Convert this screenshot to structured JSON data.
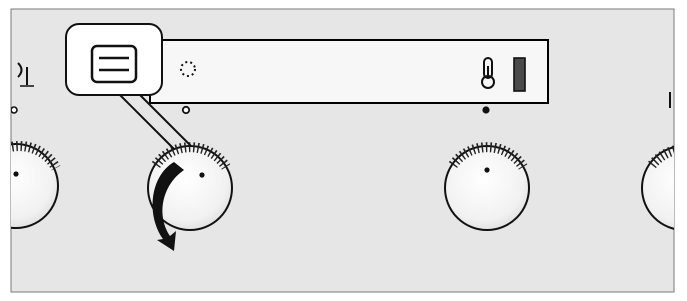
{
  "illustration": {
    "panel": {
      "background_color": "#e6e6e6",
      "frame_color": "#7a7a7a",
      "knob_fill": "#f4f4f4",
      "knob_shadow": "#bdbdbd",
      "display_fill": "#f7f7f7",
      "black": "#111111"
    },
    "display": {
      "left_icon": "dotted-circle-icon",
      "right_icon_1": "thermometer-icon",
      "right_icon_2": "heat-level-bar-icon"
    },
    "callout": {
      "icon": "menu-icon"
    },
    "knobs": [
      {
        "name": "knob-left-edge",
        "indicator": "open-dot"
      },
      {
        "name": "knob-function",
        "indicator": "open-dot",
        "rotation_arrow": true
      },
      {
        "name": "knob-temperature",
        "indicator": "filled-dot"
      },
      {
        "name": "knob-right-edge",
        "indicator": "none"
      }
    ]
  }
}
